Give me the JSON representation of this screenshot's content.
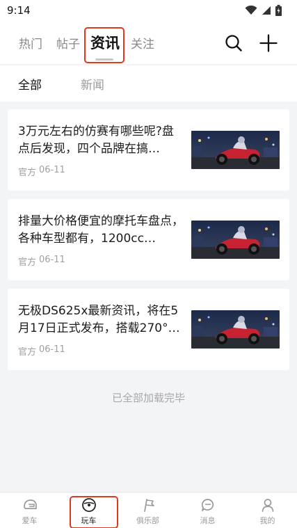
{
  "status_bar": {
    "time": "9:14"
  },
  "top_tabs": [
    {
      "label": "热门"
    },
    {
      "label": "帖子"
    },
    {
      "label": "资讯"
    },
    {
      "label": "关注"
    }
  ],
  "icons": {
    "search": "search-icon",
    "add": "plus-icon",
    "wifi": "wifi-icon",
    "signal": "signal-icon",
    "battery": "battery-icon"
  },
  "sub_tabs": [
    {
      "label": "全部"
    },
    {
      "label": "新闻"
    }
  ],
  "news": [
    {
      "title": "3万元左右的仿赛有哪些呢?盘点后发现，四个品牌在搞…",
      "source": "官方",
      "date": "06-11"
    },
    {
      "title": "排量大价格便宜的摩托车盘点，各种车型都有，1200cc…",
      "source": "官方",
      "date": "06-11"
    },
    {
      "title": "无极DS625x最新资讯，将在5月17日正式发布，搭载270°…",
      "source": "官方",
      "date": "06-11"
    }
  ],
  "list_end_text": "已全部加载完毕",
  "bottom_nav": [
    {
      "label": "爱车",
      "icon": "helmet-icon"
    },
    {
      "label": "玩车",
      "icon": "steering-wheel-icon"
    },
    {
      "label": "俱乐部",
      "icon": "flag-icon"
    },
    {
      "label": "消息",
      "icon": "message-icon"
    },
    {
      "label": "我的",
      "icon": "user-icon"
    }
  ],
  "colors": {
    "highlight": "#e0391f",
    "background": "#f3f4f6",
    "card": "#ffffff"
  }
}
